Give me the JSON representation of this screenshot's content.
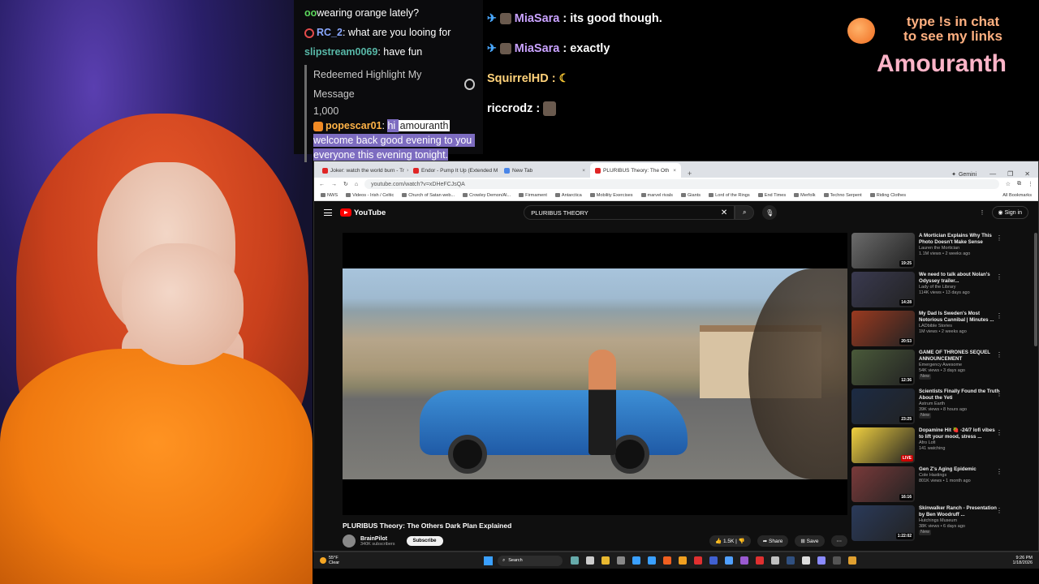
{
  "chat": {
    "line1_user": "",
    "line1_text": "wearing orange lately?",
    "line2_user": "RC_2",
    "line2_text": "what are you looing for",
    "line3_user": "slipstream0069",
    "line3_text": "have fun",
    "redeem_label": "Redeemed Highlight My Message",
    "redeem_cost": "1,000",
    "highlight_user": "popescar01",
    "highlight_word1": "hi",
    "highlight_word2": "amouranth",
    "highlight_line2": "welcome back good evening to you and",
    "highlight_line3": "everyone this evening tonight."
  },
  "overlay_chat": [
    {
      "user": "MiaSara",
      "text": "its good though."
    },
    {
      "user": "MiaSara",
      "text": "exactly"
    },
    {
      "user": "SquirrelHD",
      "text": ""
    },
    {
      "user": "riccrodz",
      "text": ""
    }
  ],
  "brand": {
    "tag_line1": "type !s in chat",
    "tag_line2": "to see my links",
    "name": "Amouranth"
  },
  "browser": {
    "tabs": [
      {
        "label": "Joker: watch the world burn - Tr"
      },
      {
        "label": "Endor - Pump It Up (Extended M"
      },
      {
        "label": "New Tab"
      },
      {
        "label": "PLURIBUS Theory: The Oth"
      }
    ],
    "gemini_label": "Gemini",
    "url": "youtube.com/watch?v=xDHeFCJsQA",
    "bookmarks": [
      "NWS",
      "Videos - Irish / Celtic",
      "Church of Satan web...",
      "Crowley Demon/Al...",
      "Firmament",
      "Antarctica",
      "Mobility Exercises",
      "marvel rivals",
      "Giants",
      "Lord of the Rings",
      "End Times",
      "Merfolk",
      "Techno Serpent",
      "Riding Clothes"
    ],
    "all_bookmarks": "All Bookmarks"
  },
  "youtube": {
    "logo": "YouTube",
    "search_value": "PLURIBUS THEORY",
    "sign_in": "Sign in",
    "video_title": "PLURIBUS Theory: The Others Dark Plan Explained",
    "channel": "BrainPilot",
    "subscribers": "340K subscribers",
    "subscribe": "Subscribe",
    "likes": "1.5K",
    "share": "Share",
    "save": "Save"
  },
  "recommendations": [
    {
      "title": "A Mortician Explains Why This Photo Doesn't Make Sense",
      "channel": "Lauren the Mortician",
      "meta": "1.1M views • 2 weeks ago",
      "duration": "19:25",
      "badge": ""
    },
    {
      "title": "We need to talk about Nolan's Odyssey trailer...",
      "channel": "Lady of the Library",
      "meta": "114K views • 13 days ago",
      "duration": "14:28",
      "badge": ""
    },
    {
      "title": "My Dad Is Sweden's Most Notorious Cannibal | Minutes ...",
      "channel": "LADbible Stories",
      "meta": "1M views • 2 weeks ago",
      "duration": "20:53",
      "badge": ""
    },
    {
      "title": "GAME OF THRONES SEQUEL ANNOUNCEMENT",
      "channel": "Emergency Awesome",
      "meta": "54K views • 3 days ago",
      "duration": "12:36",
      "badge": "New"
    },
    {
      "title": "Scientists Finally Found the Truth About the Yeti",
      "channel": "Astrum Earth",
      "meta": "39K views • 8 hours ago",
      "duration": "23:25",
      "badge": "New"
    },
    {
      "title": "Dopamine Hit 🍓 -24/7 lofi vibes to lift your mood, stress ...",
      "channel": "Afro Lofi",
      "meta": "141 watching",
      "duration": "LIVE",
      "badge": ""
    },
    {
      "title": "Gen Z's Aging Epidemic",
      "channel": "Cole Hastings",
      "meta": "801K views • 1 month ago",
      "duration": "16:16",
      "badge": ""
    },
    {
      "title": "Skinwalker Ranch - Presentation by Ben Woodruff ...",
      "channel": "Hutchings Museum",
      "meta": "38K views • 6 days ago",
      "duration": "1:22:02",
      "badge": "New"
    }
  ],
  "taskbar": {
    "temp": "55°F",
    "condition": "Clear",
    "search": "Search",
    "time": "9:26 PM",
    "date": "1/18/2026"
  }
}
